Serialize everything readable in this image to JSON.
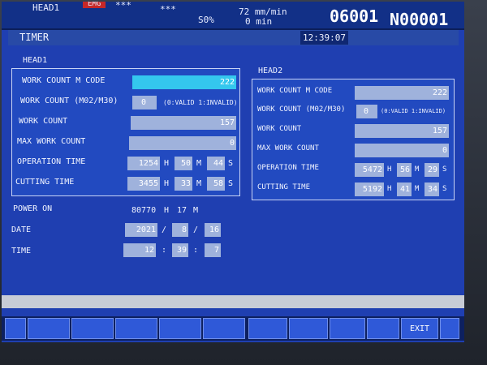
{
  "header": {
    "head": "HEAD1",
    "status1": "EMG",
    "status2": "***",
    "status3": "***",
    "feed": "72 mm/min",
    "spindle_pct": "S0%",
    "spindle": "0 min",
    "program": "06001",
    "sequence": "N00001"
  },
  "screen": {
    "title": "TIMER",
    "clock": "12:39:07"
  },
  "head1": {
    "title": "HEAD1",
    "labels": {
      "mcode": "WORK COUNT M CODE",
      "m02": "WORK COUNT (M02/M30)",
      "count": "WORK COUNT",
      "max": "MAX WORK COUNT",
      "op": "OPERATION TIME",
      "cut": "CUTTING TIME",
      "valid": "(0:VALID 1:INVALID)"
    },
    "values": {
      "mcode": "222",
      "m02": "0",
      "count": "157",
      "max": "0",
      "op_h": "1254",
      "op_m": "50",
      "op_s": "44",
      "cut_h": "3455",
      "cut_m": "33",
      "cut_s": "58"
    }
  },
  "head2": {
    "title": "HEAD2",
    "labels": {
      "mcode": "WORK COUNT M CODE",
      "m02": "WORK COUNT (M02/M30)",
      "count": "WORK COUNT",
      "max": "MAX WORK COUNT",
      "op": "OPERATION TIME",
      "cut": "CUTTING TIME",
      "valid": "(0:VALID 1:INVALID)"
    },
    "values": {
      "mcode": "222",
      "m02": "0",
      "count": "157",
      "max": "0",
      "op_h": "5472",
      "op_m": "56",
      "op_s": "29",
      "cut_h": "5192",
      "cut_m": "41",
      "cut_s": "34"
    }
  },
  "units": {
    "h": "H",
    "m": "M",
    "s": "S",
    "slash": "/",
    "colon": ":"
  },
  "power": {
    "label": "POWER ON",
    "hours": "80770",
    "minutes": "17",
    "date_label": "DATE",
    "year": "2021",
    "month": "8",
    "day": "16",
    "time_label": "TIME",
    "hh": "12",
    "mm": "39",
    "ss": "7"
  },
  "softkeys": {
    "exit": "EXIT"
  }
}
